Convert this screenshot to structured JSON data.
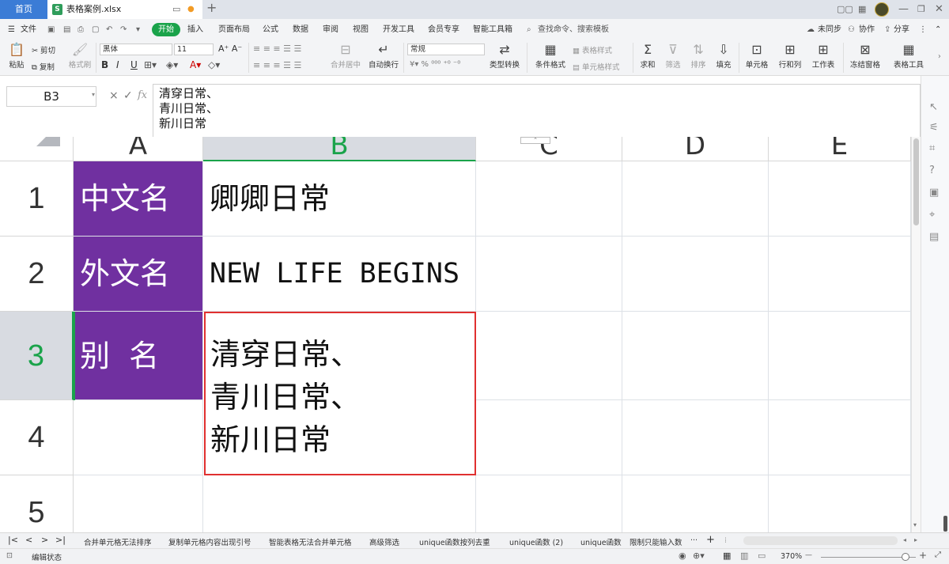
{
  "titlebar": {
    "home_tab": "首页",
    "file_tab": "表格案例.xlsx",
    "file_badge": "S",
    "add_tab": "+"
  },
  "menu": {
    "file": "文件",
    "items": [
      "开始",
      "插入",
      "页面布局",
      "公式",
      "数据",
      "审阅",
      "视图",
      "开发工具",
      "会员专享",
      "智能工具箱"
    ],
    "search": "查找命令、搜索模板",
    "sync": "未同步",
    "collab": "协作",
    "share": "分享",
    "more": "⋮",
    "collapse": "⌃"
  },
  "ribbon": {
    "paste": "粘贴",
    "cut": "剪切",
    "copy": "复制",
    "format_painter": "格式刷",
    "font_name": "黑体",
    "font_size": "11",
    "bold": "B",
    "italic": "I",
    "underline": "U",
    "merge": "合并居中",
    "wrap": "自动换行",
    "number_format": "常规",
    "type_convert": "类型转换",
    "cond_format": "条件格式",
    "table_style": "表格样式",
    "cell_style": "单元格样式",
    "sum": "求和",
    "filter": "筛选",
    "sort": "排序",
    "fill": "填充",
    "cell": "单元格",
    "rowcol": "行和列",
    "worksheet": "工作表",
    "freeze": "冻结窗格",
    "table_tools": "表格工具"
  },
  "formula_bar": {
    "cell_ref": "B3",
    "cancel": "×",
    "confirm": "✓",
    "fx": "fx",
    "content": "清穿日常、\n青川日常、\n新川日常"
  },
  "columns": [
    "A",
    "B",
    "C",
    "D",
    "E"
  ],
  "rows": [
    "1",
    "2",
    "3",
    "4",
    "5"
  ],
  "cells": {
    "A1": "中文名",
    "B1": "卿卿日常",
    "A2": "外文名",
    "B2": "NEW LIFE BEGINS",
    "A3": "别  名",
    "B3": "清穿日常、\n青川日常、\n新川日常"
  },
  "colors": {
    "accent": "#1aa34a",
    "purple": "#7030a0",
    "selection": "#e03030",
    "home_tab": "#3b7cd6"
  },
  "sheets": [
    "合并单元格无法排序",
    "复制单元格内容出现引号",
    "智能表格无法合并单元格",
    "高级筛选",
    "unique函数按列去重",
    "unique函数 (2)",
    "unique函数",
    "限制只能输入数"
  ],
  "sheet_nav": [
    "|<",
    "<",
    ">",
    ">|"
  ],
  "sheet_more": "···",
  "sheet_add": "+",
  "status": {
    "mode": "编辑状态",
    "zoom": "370%",
    "zoom_minus": "—",
    "zoom_plus": "+"
  }
}
